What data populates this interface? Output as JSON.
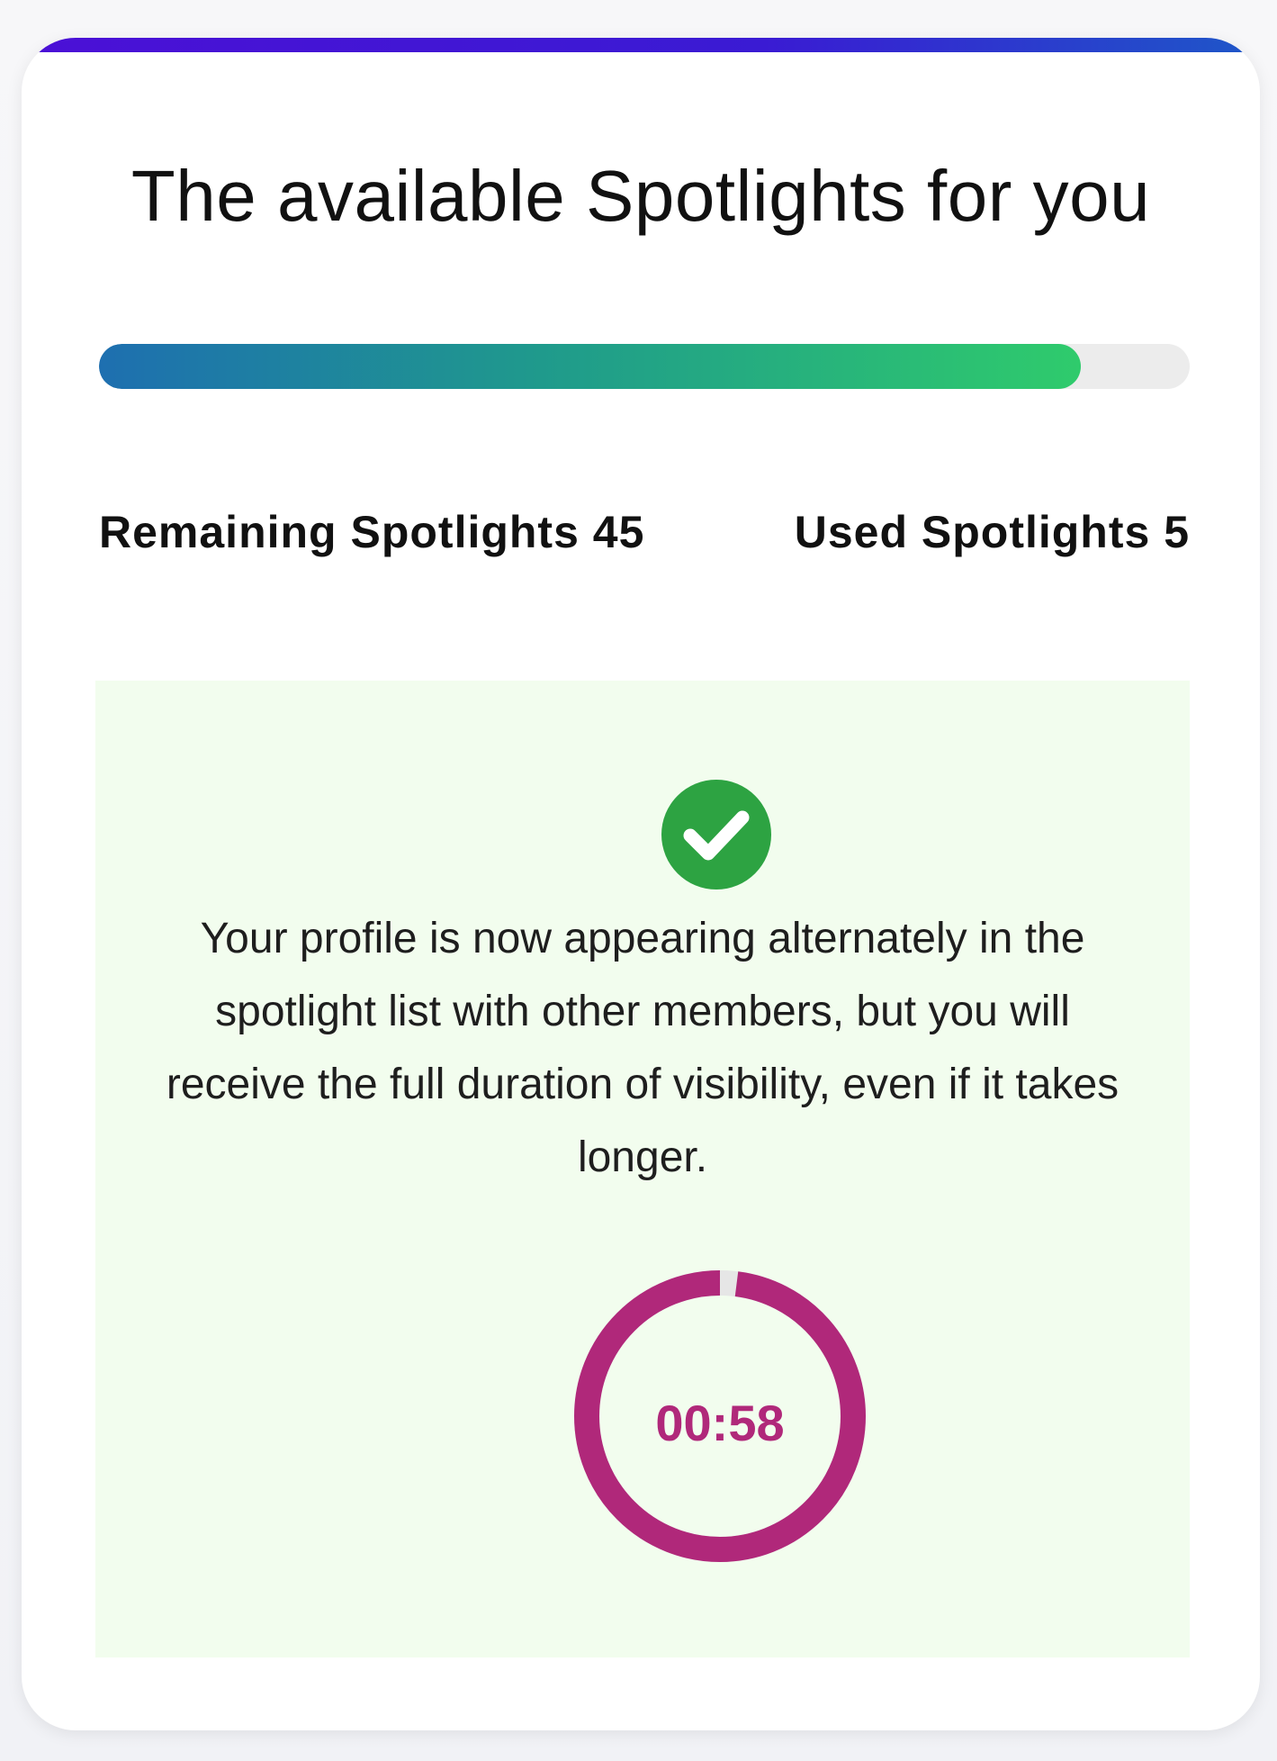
{
  "card": {
    "title": "The available Spotlights for you"
  },
  "progress": {
    "fraction_remaining": 0.9
  },
  "stats": {
    "remaining_label": "Remaining Spotlights 45",
    "used_label": "Used Spotlights 5"
  },
  "notice": {
    "icon": "check-circle-icon",
    "message": "Your profile is now appearing alternately in the spotlight list with other members, but you will receive the full duration of visibility, even if it takes longer."
  },
  "timer": {
    "label": "00:58",
    "fraction_elapsed": 0.02
  },
  "colors": {
    "accent_top": "#4b10d6",
    "progress_start": "#1e6fb0",
    "progress_end": "#2fcb6c",
    "notice_bg": "#f2fdee",
    "check_green": "#2da342",
    "timer_color": "#b0287a"
  }
}
